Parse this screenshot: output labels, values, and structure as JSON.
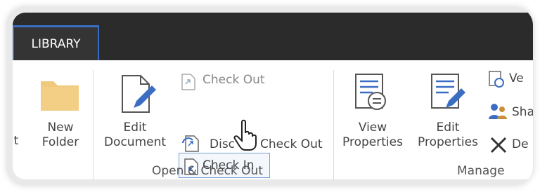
{
  "tab": {
    "label": "LIBRARY"
  },
  "buttons": {
    "new_folder": "New\nFolder",
    "partial_left": "t",
    "edit_document": "Edit\nDocument",
    "check_out": "Check Out",
    "check_in": "Check In",
    "discard_check_out_part1": "Disc",
    "discard_check_out_part2": "Check Out",
    "view_properties": "View\nProperties",
    "edit_properties": "Edit\nProperties",
    "version_partial": "Ve",
    "share_partial": "Sha",
    "delete_partial": "De"
  },
  "groups": {
    "open_checkout": "Open & Check Out",
    "manage": "Manage"
  },
  "colors": {
    "accent": "#3b6ec2",
    "folder": "#f0c97c",
    "dark_bar": "#2b2b2b"
  }
}
